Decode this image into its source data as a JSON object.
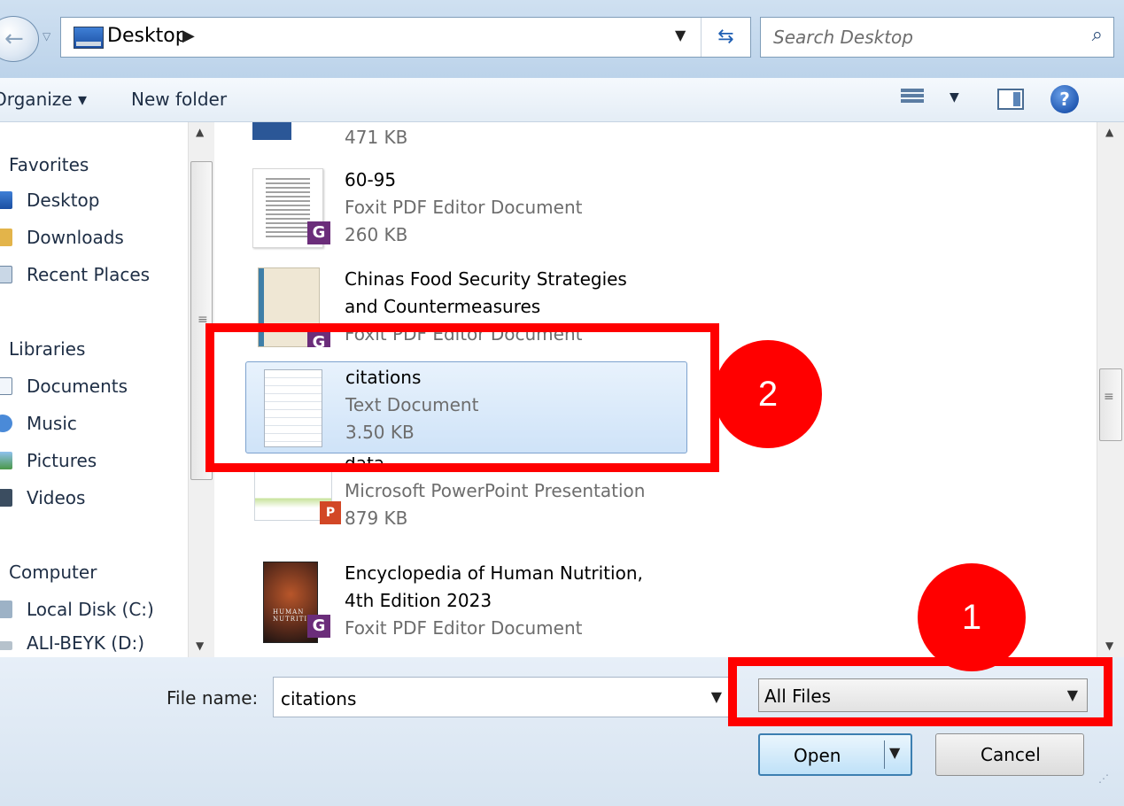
{
  "address_bar": {
    "location": "Desktop",
    "search_placeholder": "Search Desktop"
  },
  "toolbar": {
    "organize_label": "Organize ▾",
    "new_folder_label": "New folder"
  },
  "nav": {
    "favorites": {
      "label": "Favorites",
      "items": [
        "Desktop",
        "Downloads",
        "Recent Places"
      ]
    },
    "libraries": {
      "label": "Libraries",
      "items": [
        "Documents",
        "Music",
        "Pictures",
        "Videos"
      ]
    },
    "computer": {
      "label": "Computer",
      "items": [
        "Local Disk (C:)",
        "ALI-BEYK (D:)"
      ]
    }
  },
  "files": [
    {
      "name": "",
      "type": "",
      "size": "471 KB"
    },
    {
      "name": "60-95",
      "type": "Foxit PDF Editor Document",
      "size": "260 KB"
    },
    {
      "name": "Chinas Food Security Strategies",
      "name2": "and Countermeasures",
      "type": "Foxit PDF Editor Document"
    },
    {
      "name": "citations",
      "type": "Text Document",
      "size": "3.50 KB",
      "selected": true
    },
    {
      "name": "data",
      "type": "Microsoft PowerPoint Presentation",
      "size": "879 KB"
    },
    {
      "name": "Encyclopedia of Human Nutrition,",
      "name2": "4th Edition 2023",
      "type": "Foxit PDF Editor Document"
    }
  ],
  "thumb_text": {
    "nutrition_cover": "HUMAN NUTRITION"
  },
  "bottom": {
    "file_name_label": "File name:",
    "file_name_value": "citations",
    "file_type_value": "All Files",
    "open_label": "Open",
    "cancel_label": "Cancel"
  },
  "annotations": {
    "badge_1": "1",
    "badge_2": "2"
  },
  "colors": {
    "highlight": "#ff0000",
    "selection": "#cfe3f8",
    "foxit": "#6b2d7a"
  }
}
